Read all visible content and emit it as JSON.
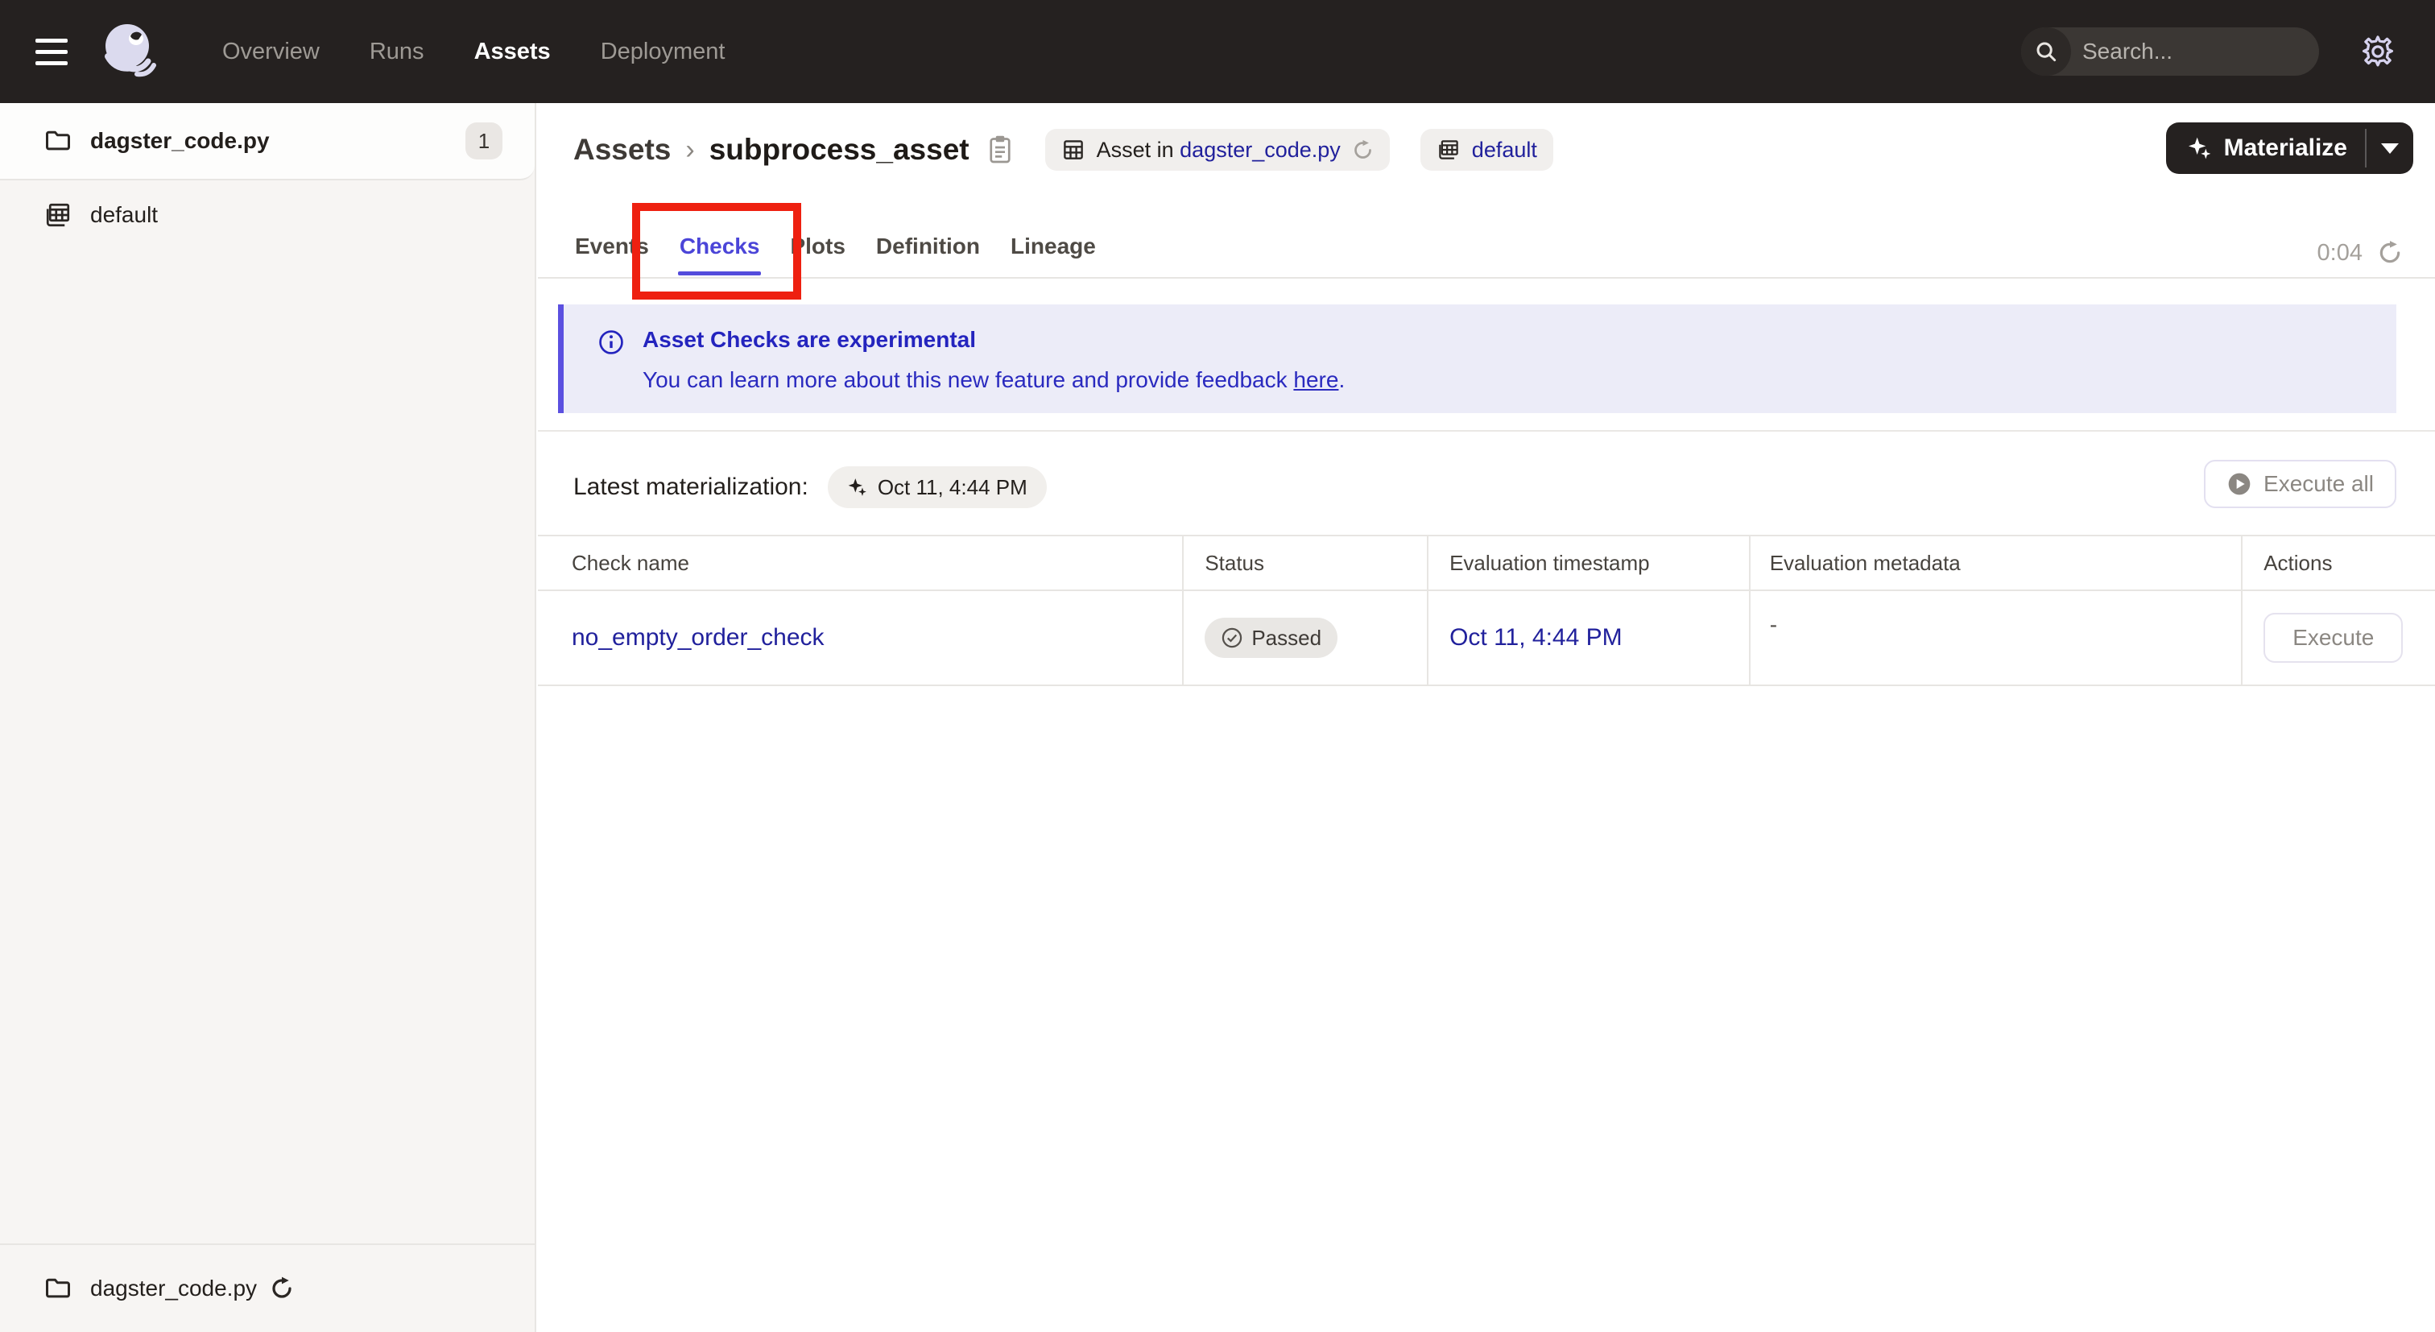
{
  "topnav": {
    "menu": [
      {
        "label": "Overview",
        "active": false
      },
      {
        "label": "Runs",
        "active": false
      },
      {
        "label": "Assets",
        "active": true
      },
      {
        "label": "Deployment",
        "active": false
      }
    ],
    "search": {
      "placeholder": "Search...",
      "shortcut": "/"
    }
  },
  "sidebar": {
    "top_item": {
      "label": "dagster_code.py",
      "count": "1"
    },
    "items": [
      {
        "label": "default"
      }
    ],
    "footer": {
      "label": "dagster_code.py"
    }
  },
  "header": {
    "breadcrumb": {
      "root": "Assets",
      "separator": "›",
      "current": "subprocess_asset"
    },
    "tags": [
      {
        "prefix": "Asset in",
        "link": "dagster_code.py"
      },
      {
        "prefix": "",
        "link": "default"
      }
    ],
    "materialize_label": "Materialize"
  },
  "tabs": {
    "items": [
      {
        "label": "Events"
      },
      {
        "label": "Checks"
      },
      {
        "label": "Plots"
      },
      {
        "label": "Definition"
      },
      {
        "label": "Lineage"
      }
    ],
    "active": "Checks",
    "timer": "0:04"
  },
  "banner": {
    "title": "Asset Checks are experimental",
    "body": "You can learn more about this new feature and provide feedback",
    "link_text": "here",
    "suffix": "."
  },
  "materialization": {
    "label": "Latest materialization:",
    "badge": "Oct 11, 4:44 PM"
  },
  "execute_all_label": "Execute all",
  "table": {
    "headers": [
      "Check name",
      "Status",
      "Evaluation timestamp",
      "Evaluation metadata",
      "Actions"
    ],
    "rows": [
      {
        "check_name": "no_empty_order_check",
        "status": "Passed",
        "evaluation_timestamp": "Oct 11, 4:44 PM",
        "evaluation_metadata": "-",
        "action": "Execute"
      }
    ]
  },
  "colors": {
    "nav_bg": "#252120",
    "accent_indigo": "#4B45D8",
    "link_navy": "#21219C",
    "banner_bg": "#ECECF8",
    "banner_text": "#2A2ABF",
    "annotation_red": "#EE2010"
  }
}
